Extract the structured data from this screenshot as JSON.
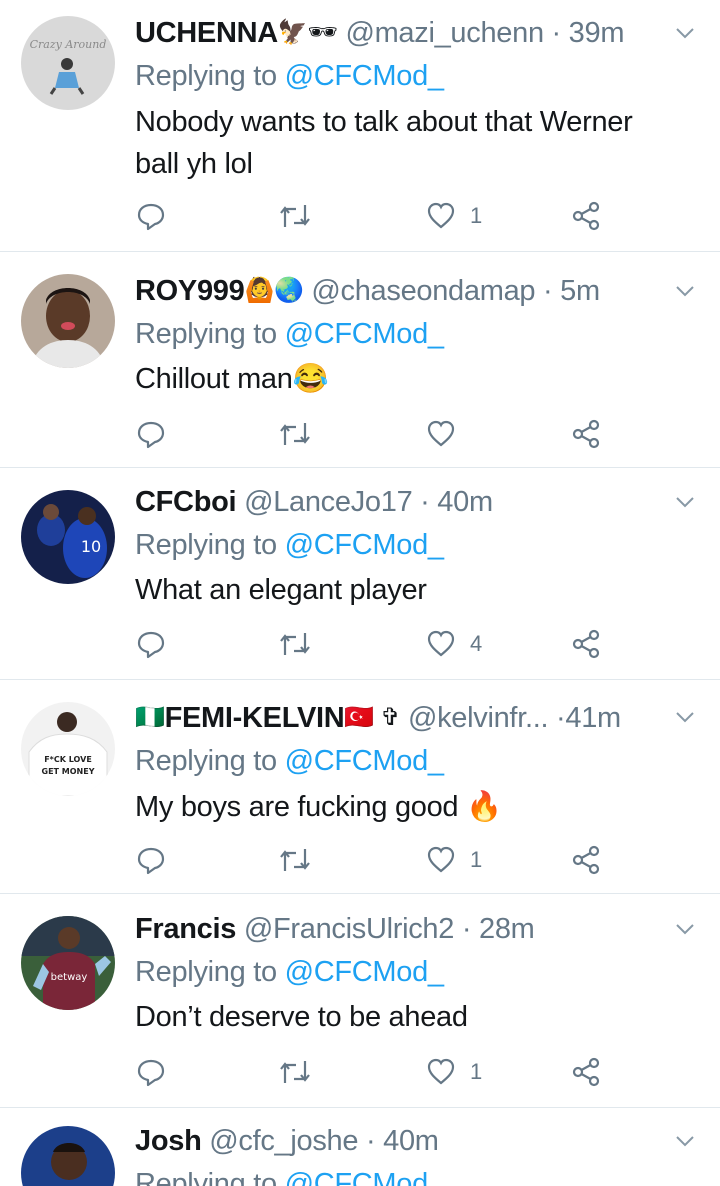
{
  "tweets": [
    {
      "name": "UCHENNA",
      "name_emoji": "🦅🕶",
      "handle": "@mazi_uchenn",
      "separator": "·",
      "time": "39m",
      "replying_prefix": "Replying to",
      "replying_to": "@CFCMod_",
      "text_lines": [
        "Nobody wants to talk about that Werner",
        "ball yh lol"
      ],
      "like_count": "1",
      "avatar_icon": "avatar-crazy-around-logo"
    },
    {
      "name": "ROY999",
      "name_emoji": "🙆🌏",
      "handle": "@chaseondamap",
      "separator": "·",
      "time": "5m",
      "replying_prefix": "Replying to",
      "replying_to": "@CFCMod_",
      "text_lines": [
        "Chillout man😂"
      ],
      "like_count": "",
      "avatar_icon": "avatar-selfie"
    },
    {
      "name": "CFCboi",
      "name_emoji": "",
      "handle": "@LanceJo17",
      "separator": "·",
      "time": "40m",
      "replying_prefix": "Replying to",
      "replying_to": "@CFCMod_",
      "text_lines": [
        "What an elegant player"
      ],
      "like_count": "4",
      "avatar_icon": "avatar-football-players",
      "avatar_number": "10"
    },
    {
      "name_prefix_emoji": "🇳🇬",
      "name": "FEMI-KELVIN",
      "name_emoji": "🇹🇷 ✞",
      "handle": "@kelvinfr...",
      "separator": "·",
      "time": "41m",
      "replying_prefix": "Replying to",
      "replying_to": "@CFCMod_",
      "text_lines": [
        "My boys are fucking good 🔥"
      ],
      "like_count": "1",
      "avatar_icon": "avatar-tshirt",
      "avatar_shirt_line1": "F*CK LOVE",
      "avatar_shirt_line2": "GET MONEY"
    },
    {
      "name": "Francis",
      "name_emoji": "",
      "handle": "@FrancisUlrich2",
      "separator": "·",
      "time": "28m",
      "replying_prefix": "Replying to",
      "replying_to": "@CFCMod_",
      "text_lines": [
        "Don’t deserve to be ahead"
      ],
      "like_count": "1",
      "avatar_icon": "avatar-footballer-westham",
      "avatar_sponsor": "betway"
    },
    {
      "name": "Josh",
      "name_emoji": "",
      "handle": "@cfc_joshe",
      "separator": "·",
      "time": "40m",
      "replying_prefix": "Replying to",
      "replying_to": "@CFCMod_",
      "text_lines": [],
      "like_count": "",
      "avatar_icon": "avatar-footballer"
    }
  ],
  "icons": {
    "reply": "reply-icon",
    "retweet": "retweet-icon",
    "like": "heart-icon",
    "share": "share-icon",
    "caret": "chevron-down-icon"
  },
  "colors": {
    "text": "#14171a",
    "secondary": "#657786",
    "accent": "#1da1f2",
    "divider": "#e1e8ed"
  }
}
